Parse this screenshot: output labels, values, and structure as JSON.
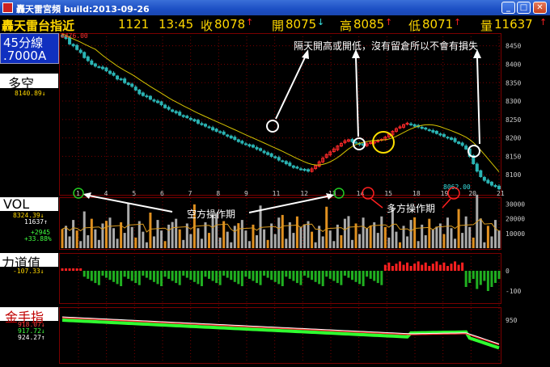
{
  "window": {
    "title": "轟天雷宮頻 build:2013-09-26",
    "min": "_",
    "max": "□",
    "close": "✕"
  },
  "quote": {
    "name": "轟天雷台指近",
    "code": "1121",
    "time": "13:45",
    "close_label": "收",
    "close": "8078",
    "close_arrow": "↑",
    "open_label": "開",
    "open": "8075",
    "open_arrow": "↓",
    "high_label": "高",
    "high": "8085",
    "high_arrow": "↑",
    "low_label": "低",
    "low": "8071",
    "low_arrow": "↑",
    "vol_label": "量",
    "vol": "11637",
    "vol_arrow": "↑"
  },
  "side": {
    "period": "45分線",
    "account": ".7000A",
    "panel1": "多空",
    "panel1_val": "8140.89↓",
    "panel2": "VOL",
    "panel2_v1": "8324.39↓",
    "panel2_v2": "11637↑",
    "panel2_v3": "+2945",
    "panel2_v4": "+33.88%",
    "panel3": "力道值",
    "panel3_val": "-107.33↓",
    "panel4": "金手指",
    "panel4_v1": "918.07↓",
    "panel4_v2": "917.72↓",
    "panel4_v3": "924.27↑"
  },
  "main": {
    "top_label": "8476.00",
    "last_label": "8062.00",
    "y_ticks": [
      "8450",
      "8400",
      "8350",
      "8300",
      "8250",
      "8200",
      "8150",
      "8100"
    ],
    "x_ticks": [
      "1",
      "4",
      "5",
      "6",
      "7",
      "8",
      "9",
      "11",
      "12",
      "13",
      "14",
      "15",
      "18",
      "19",
      "20",
      "21"
    ]
  },
  "vol": {
    "y_ticks": [
      "30000",
      "20000",
      "10000"
    ]
  },
  "power": {
    "y_ticks": [
      "0",
      "-100"
    ]
  },
  "gold": {
    "y_ticks": [
      "950"
    ]
  },
  "annotations": {
    "top_note": "隔天開高或開低，沒有留倉所以不會有損失",
    "short_period": "空方操作期",
    "long_period": "多方操作期"
  },
  "colors": {
    "up": "#ff2a2a",
    "down": "#2bb5b5",
    "ma": "#d4c200",
    "vol_bar": "#aaaaaa",
    "vol_ma": "#d89a20",
    "grid": "#7a0000",
    "quote_yellow": "#ffd700",
    "quote_red": "#ff2020",
    "quote_cyan": "#38e0e0"
  },
  "chart_data": {
    "type": "candlestick",
    "title": "",
    "y_range": [
      8050,
      8480
    ],
    "x_range_bars": [
      0,
      119
    ],
    "candle_close_series": [
      8476,
      8470,
      8455,
      8450,
      8440,
      8432,
      8418,
      8410,
      8400,
      8395,
      8392,
      8388,
      8382,
      8375,
      8370,
      8360,
      8358,
      8350,
      8345,
      8340,
      8330,
      8320,
      8315,
      8312,
      8305,
      8300,
      8296,
      8290,
      8282,
      8278,
      8272,
      8268,
      8262,
      8258,
      8255,
      8250,
      8246,
      8240,
      8236,
      8232,
      8228,
      8222,
      8218,
      8215,
      8210,
      8205,
      8200,
      8196,
      8190,
      8186,
      8182,
      8178,
      8175,
      8170,
      8166,
      8160,
      8155,
      8150,
      8146,
      8140,
      8136,
      8130,
      8125,
      8120,
      8118,
      8115,
      8112,
      8110,
      8116,
      8125,
      8135,
      8145,
      8155,
      8162,
      8170,
      8178,
      8185,
      8192,
      8195,
      8190,
      8186,
      8182,
      8180,
      8184,
      8188,
      8190,
      8192,
      8196,
      8202,
      8210,
      8218,
      8225,
      8230,
      8236,
      8240,
      8236,
      8232,
      8230,
      8226,
      8224,
      8220,
      8216,
      8212,
      8208,
      8204,
      8200,
      8196,
      8190,
      8185,
      8180,
      8170,
      8150,
      8130,
      8110,
      8095,
      8085,
      8078,
      8072,
      8068,
      8062
    ]
  }
}
